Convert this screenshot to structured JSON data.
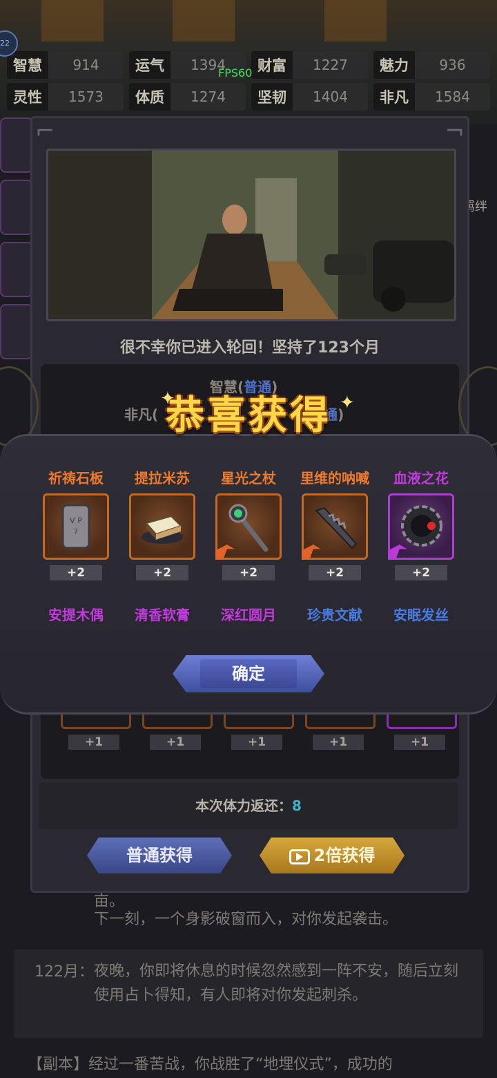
{
  "stats": [
    {
      "name": "智慧",
      "value": "914"
    },
    {
      "name": "运气",
      "value": "1394"
    },
    {
      "name": "财富",
      "value": "1227"
    },
    {
      "name": "魅力",
      "value": "936"
    },
    {
      "name": "灵性",
      "value": "1573"
    },
    {
      "name": "体质",
      "value": "1274"
    },
    {
      "name": "坚韧",
      "value": "1404"
    },
    {
      "name": "非凡",
      "value": "1584"
    }
  ],
  "fps": "FPS60",
  "side_badge": "22",
  "right_edge_text": "羁绊",
  "result_text": "很不幸你已进入轮回！坚持了123个月",
  "peek": {
    "line1_label": "智慧(",
    "line1_value": "普通",
    "line1_close": ")",
    "line2_label": "非凡(",
    "line2_value": "普通",
    "line2_close": ")"
  },
  "banner_title": "恭喜获得",
  "rewards": [
    {
      "name": "祈祷石板",
      "count": "+2",
      "rarity": "orange",
      "icon": "stone-tablet-icon"
    },
    {
      "name": "提拉米苏",
      "count": "+2",
      "rarity": "orange",
      "icon": "tiramisu-icon"
    },
    {
      "name": "星光之杖",
      "count": "+2",
      "rarity": "orange",
      "icon": "staff-icon"
    },
    {
      "name": "里维的呐喊",
      "count": "+2",
      "rarity": "orange",
      "icon": "blade-icon"
    },
    {
      "name": "血液之花",
      "count": "+2",
      "rarity": "purple",
      "icon": "eye-flower-icon"
    }
  ],
  "rewards_row2": [
    {
      "name": "安提木偶",
      "rarity": "purple"
    },
    {
      "name": "清香软膏",
      "rarity": "purple"
    },
    {
      "name": "深红圆月",
      "rarity": "purple"
    },
    {
      "name": "珍贵文献",
      "rarity": "blue"
    },
    {
      "name": "安眠发丝",
      "rarity": "blue"
    }
  ],
  "confirm_label": "确定",
  "under_counts": [
    "+1",
    "+1",
    "+1",
    "+1",
    "+1"
  ],
  "refund": {
    "label": "本次体力返还：",
    "value": "8"
  },
  "btn_normal": "普通获得",
  "btn_double": "2倍获得",
  "log": {
    "partial_1": "亩。",
    "partial_2": "下一刻，一个身影破窗而入，对你发起袭击。",
    "entry_month": "122月：",
    "entry_text": "夜晚，你即将休息的时候忽然感到一阵不安，随后立刻使用占卜得知，有人即将对你发起刺杀。",
    "bottom": "【副本】经过一番苦战，你战胜了“地埋仪式”，成功的"
  },
  "colors": {
    "orange": "#f07a2a",
    "purple": "#c13bdc",
    "blue": "#4a7be0",
    "gold": "#ffd84a"
  }
}
